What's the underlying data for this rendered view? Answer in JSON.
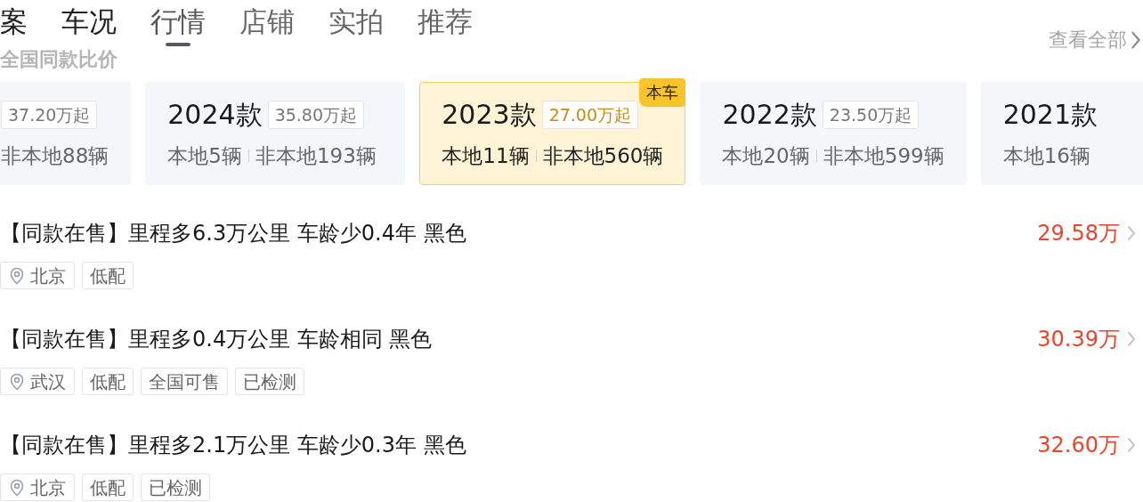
{
  "header": {
    "title": "全国同款比价",
    "view_all": "查看全部"
  },
  "tabs": [
    {
      "label": "案",
      "selected": false
    },
    {
      "label": "车况",
      "selected": false
    },
    {
      "label": "行情",
      "selected": true
    },
    {
      "label": "店铺",
      "selected": false
    },
    {
      "label": "实拍",
      "selected": false
    },
    {
      "label": "推荐",
      "selected": false
    }
  ],
  "model_years": [
    {
      "price": "37.20万起",
      "nonlocal": "非本地88辆",
      "selected": false
    },
    {
      "year": "2024款",
      "price": "35.80万起",
      "local": "本地5辆",
      "nonlocal": "非本地193辆",
      "selected": false
    },
    {
      "year": "2023款",
      "price": "27.00万起",
      "local": "本地11辆",
      "nonlocal": "非本地560辆",
      "selected": true,
      "badge": "本车"
    },
    {
      "year": "2022款",
      "price": "23.50万起",
      "local": "本地20辆",
      "nonlocal": "非本地599辆",
      "selected": false
    },
    {
      "year": "2021款",
      "local": "本地16辆",
      "selected": false
    }
  ],
  "listings": [
    {
      "title": "【同款在售】里程多6.3万公里 车龄少0.4年 黑色",
      "price": "29.58万",
      "location": "北京",
      "tags": [
        "低配"
      ]
    },
    {
      "title": "【同款在售】里程多0.4万公里 车龄相同 黑色",
      "price": "30.39万",
      "location": "武汉",
      "tags": [
        "低配",
        "全国可售",
        "已检测"
      ]
    },
    {
      "title": "【同款在售】里程多2.1万公里 车龄少0.3年 黑色",
      "price": "32.60万",
      "location": "北京",
      "tags": [
        "低配",
        "已检测"
      ]
    }
  ]
}
